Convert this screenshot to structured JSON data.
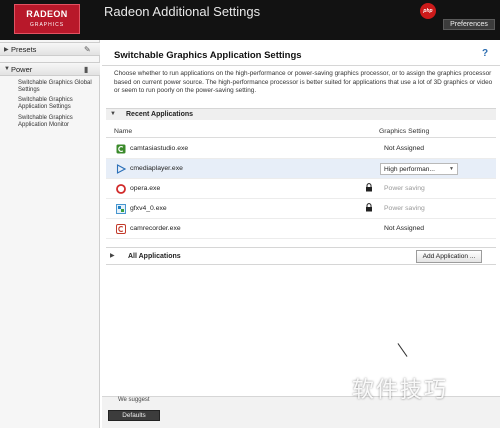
{
  "window": {
    "logo_line1": "RADEON",
    "logo_line2": "GRAPHICS",
    "title": "Radeon Additional Settings",
    "preferences_label": "Preferences",
    "watermark_badge": "php"
  },
  "sidebar": {
    "sections": [
      {
        "label": "Presets",
        "icon": "pencil-icon",
        "expanded": false
      },
      {
        "label": "Power",
        "icon": "battery-icon",
        "expanded": true
      }
    ],
    "power_items": [
      "Switchable Graphics Global Settings",
      "Switchable Graphics Application Settings",
      "Switchable Graphics Application Monitor"
    ]
  },
  "main": {
    "title": "Switchable Graphics Application Settings",
    "help_icon": "?",
    "description": "Choose whether to run applications on the high-performance or power-saving graphics processor, or to assign the graphics processor based on current power source. The high-performance processor is better suited for applications that use a lot of 3D graphics or video or seem to run poorly on the power-saving setting.",
    "recent_section_label": "Recent Applications",
    "columns": {
      "name": "Name",
      "setting": "Graphics Setting"
    },
    "apps": [
      {
        "name": "camtasiastudio.exe",
        "setting": "Not Assigned",
        "locked": false,
        "icon": "camtasia-icon",
        "icon_color": "#3a8a2a"
      },
      {
        "name": "cmediaplayer.exe",
        "setting": "High performan...",
        "locked": false,
        "icon": "play-icon",
        "icon_color": "#2a6fb8",
        "selected": true
      },
      {
        "name": "opera.exe",
        "setting": "Power saving",
        "locked": true,
        "icon": "opera-icon",
        "icon_color": "#d12a2a"
      },
      {
        "name": "gfxv4_0.exe",
        "setting": "Power saving",
        "locked": true,
        "icon": "gfx-icon",
        "icon_color": "#1e7fc4"
      },
      {
        "name": "camrecorder.exe",
        "setting": "Not Assigned",
        "locked": false,
        "icon": "recorder-icon",
        "icon_color": "#c23a2a"
      }
    ],
    "all_section_label": "All Applications",
    "add_app_label": "Add Application ..."
  },
  "bottom": {
    "suggest_text": "We suggest",
    "defaults_label": "Defaults"
  },
  "overlay": {
    "cn_watermark": "软件技巧"
  }
}
